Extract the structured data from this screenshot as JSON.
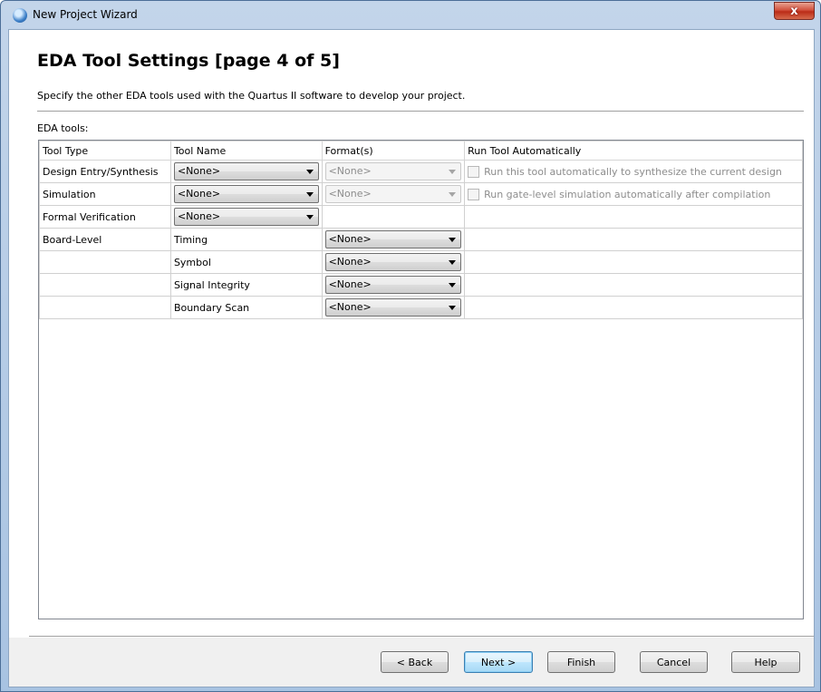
{
  "window": {
    "title": "New Project Wizard",
    "close_glyph": "x"
  },
  "page": {
    "title": "EDA Tool Settings [page 4 of 5]",
    "description": "Specify the other EDA tools used with the Quartus II software to develop your project.",
    "tools_label": "EDA tools:"
  },
  "table": {
    "headers": [
      "Tool Type",
      "Tool Name",
      "Format(s)",
      "Run Tool Automatically"
    ],
    "rows": [
      {
        "type": "Design Entry/Synthesis",
        "name": "<None>",
        "format": "<None>",
        "auto": "Run this tool automatically to synthesize the current design"
      },
      {
        "type": "Simulation",
        "name": "<None>",
        "format": "<None>",
        "auto": "Run gate-level simulation automatically after compilation"
      },
      {
        "type": "Formal Verification",
        "name": "<None>"
      },
      {
        "type": "Board-Level",
        "name": "Timing",
        "format": "<None>"
      },
      {
        "type": "",
        "name": "Symbol",
        "format": "<None>"
      },
      {
        "type": "",
        "name": "Signal Integrity",
        "format": "<None>"
      },
      {
        "type": "",
        "name": "Boundary Scan",
        "format": "<None>"
      }
    ]
  },
  "buttons": {
    "back": "< Back",
    "next": "Next >",
    "finish": "Finish",
    "cancel": "Cancel",
    "help": "Help"
  },
  "colors": {
    "title_bar": "#b9d1ea",
    "close": "#c8402b",
    "accent": "#3c7fb1"
  }
}
